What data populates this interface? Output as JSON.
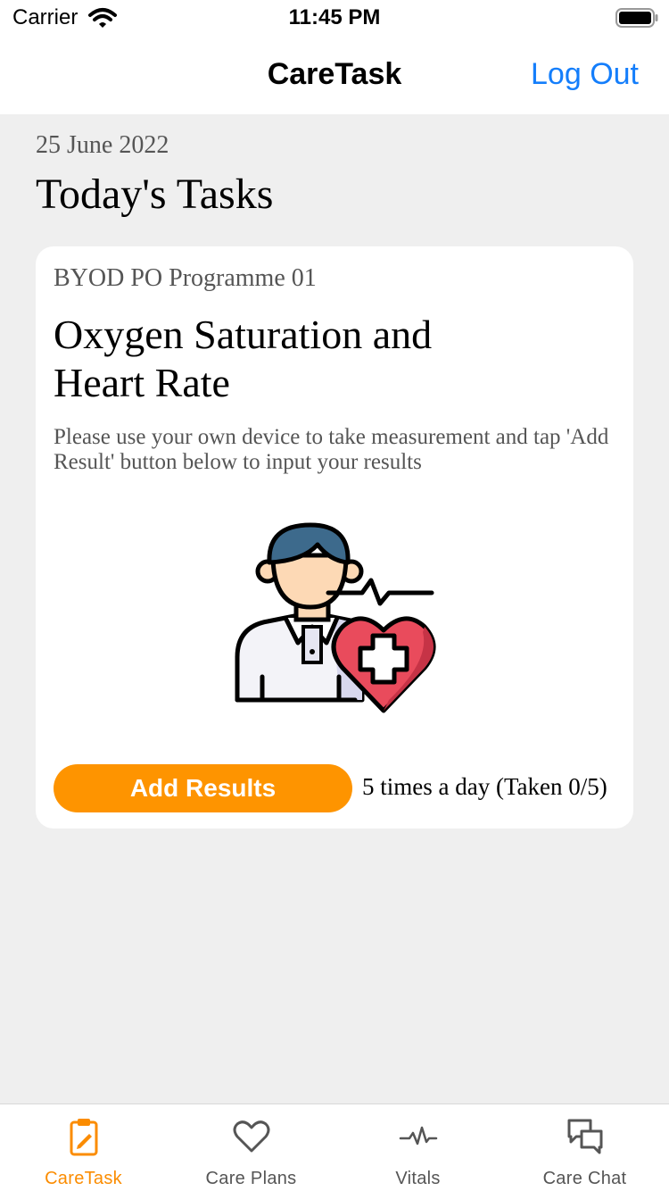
{
  "status_bar": {
    "carrier": "Carrier",
    "time": "11:45 PM",
    "icons": [
      "wifi-icon",
      "battery-icon"
    ]
  },
  "nav": {
    "title": "CareTask",
    "logout_label": "Log Out"
  },
  "date": "25 June 2022",
  "page_title": "Today's Tasks",
  "task": {
    "programme": "BYOD PO Programme 01",
    "title": "Oxygen Saturation and Heart Rate",
    "description": "Please use your own device to take measurement and tap 'Add Result' button below to input your results",
    "illustration": "patient-heart-icon",
    "button_label": "Add Results",
    "frequency": "5 times a day (Taken 0/5)"
  },
  "tabs": [
    {
      "label": "CareTask",
      "icon": "clipboard-icon",
      "active": true
    },
    {
      "label": "Care Plans",
      "icon": "heart-icon",
      "active": false
    },
    {
      "label": "Vitals",
      "icon": "pulse-icon",
      "active": false
    },
    {
      "label": "Care Chat",
      "icon": "chat-icon",
      "active": false
    }
  ],
  "colors": {
    "accent_orange": "#fe9400",
    "link_blue": "#147efb",
    "background": "#efefef",
    "heart_red": "#e94b5c",
    "hair_blue": "#3d6a8c"
  }
}
